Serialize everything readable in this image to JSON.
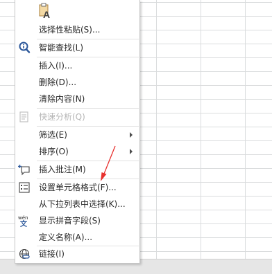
{
  "context_menu": {
    "paste_icon": "paste-text-only-icon",
    "items": [
      {
        "label": "选择性粘贴(S)...",
        "icon": "",
        "disabled": false,
        "submenu": false
      },
      {
        "label": "智能查找(L)",
        "icon": "smart-lookup-icon",
        "disabled": false,
        "submenu": false
      },
      {
        "label": "插入(I)...",
        "icon": "",
        "disabled": false,
        "submenu": false
      },
      {
        "label": "删除(D)...",
        "icon": "",
        "disabled": false,
        "submenu": false
      },
      {
        "label": "清除内容(N)",
        "icon": "",
        "disabled": false,
        "submenu": false
      },
      {
        "label": "快速分析(Q)",
        "icon": "quick-analysis-icon",
        "disabled": true,
        "submenu": false
      },
      {
        "label": "筛选(E)",
        "icon": "",
        "disabled": false,
        "submenu": true
      },
      {
        "label": "排序(O)",
        "icon": "",
        "disabled": false,
        "submenu": true
      },
      {
        "label": "插入批注(M)",
        "icon": "insert-comment-icon",
        "disabled": false,
        "submenu": false
      },
      {
        "label": "设置单元格格式(F)...",
        "icon": "format-cells-icon",
        "disabled": false,
        "submenu": false
      },
      {
        "label": "从下拉列表中选择(K)...",
        "icon": "",
        "disabled": false,
        "submenu": false
      },
      {
        "label": "显示拼音字段(S)",
        "icon": "phonetic-guide-icon",
        "disabled": false,
        "submenu": false
      },
      {
        "label": "定义名称(A)...",
        "icon": "",
        "disabled": false,
        "submenu": false
      },
      {
        "label": "链接(I)",
        "icon": "link-icon",
        "disabled": false,
        "submenu": false
      }
    ]
  },
  "phonetic_icon_text": {
    "top": "wén",
    "bottom": "文"
  },
  "paste_icon_letter": "A",
  "colors": {
    "accent": "#2b579a",
    "annotation_arrow": "#e8312f",
    "grid": "#dadcdd",
    "menu_text": "#262626",
    "disabled_text": "#b5b5b5"
  }
}
